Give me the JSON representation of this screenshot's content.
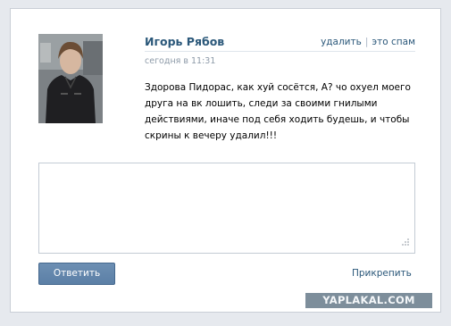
{
  "message": {
    "author": "Игорь Рябов",
    "time": "сегодня в 11:31",
    "text": "Здорова Пидорас, как хуй сосётся, А? чо охуел моего друга на вк лошить, следи за своими гнилыми действиями, иначе под себя ходить будешь, и чтобы скрины к вечеру удалил!!!",
    "actions": {
      "delete_label": "удалить",
      "spam_label": "это спам"
    }
  },
  "reply": {
    "value": "",
    "send_label": "Ответить",
    "attach_label": "Прикрепить"
  },
  "watermark": "YAPLAKAL.COM",
  "colors": {
    "link": "#2b587a",
    "button": "#5b7fa6",
    "border": "#c3cbd4"
  }
}
